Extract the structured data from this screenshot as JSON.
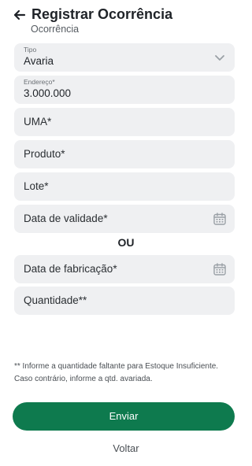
{
  "header": {
    "title": "Registrar Ocorrência",
    "subtitle": "Ocorrência"
  },
  "form": {
    "tipo": {
      "label": "Tipo",
      "value": "Avaria"
    },
    "endereco": {
      "label": "Endereço*",
      "value": "3.000.000"
    },
    "uma": {
      "placeholder": "UMA*"
    },
    "produto": {
      "placeholder": "Produto*"
    },
    "lote": {
      "placeholder": "Lote*"
    },
    "validade": {
      "placeholder": "Data de validade*"
    },
    "separator": "OU",
    "fabricacao": {
      "placeholder": "Data de fabricação*"
    },
    "quantidade": {
      "placeholder": "Quantidade**"
    }
  },
  "note": "** Informe a quantidade faltante para Estoque Insuficiente. Caso contrário, informe a qtd. avariada.",
  "actions": {
    "submit_label": "Enviar",
    "back_label": "Voltar"
  },
  "colors": {
    "primary": "#0e7a4e",
    "field_bg": "#eff0f2"
  },
  "icons": {
    "back": "arrow-left-icon",
    "dropdown": "chevron-down-icon",
    "calendar": "calendar-icon"
  }
}
